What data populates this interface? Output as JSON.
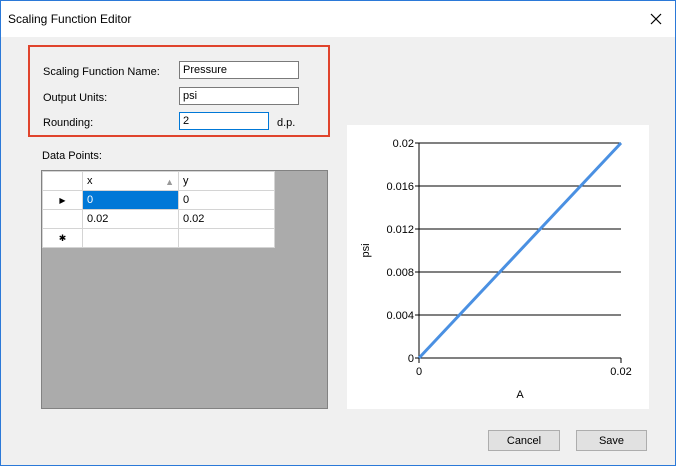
{
  "window": {
    "title": "Scaling Function Editor",
    "close_glyph": "✕"
  },
  "form": {
    "name_label": "Scaling Function Name:",
    "name_value": "Pressure",
    "units_label": "Output Units:",
    "units_value": "psi",
    "rounding_label": "Rounding:",
    "rounding_value": "2",
    "rounding_suffix": "d.p.",
    "highlight_color": "#e0442c"
  },
  "grid": {
    "label": "Data Points:",
    "columns": [
      "x",
      "y"
    ],
    "sorted_column": "x",
    "rows": [
      {
        "marker": "▶",
        "x": "0",
        "y": "0"
      },
      {
        "marker": "",
        "x": "0.02",
        "y": "0.02"
      },
      {
        "marker": "✱",
        "x": "",
        "y": ""
      }
    ]
  },
  "chart_data": {
    "type": "line",
    "title": "",
    "xlabel": "A",
    "ylabel": "psi",
    "xlim": [
      0,
      0.02
    ],
    "ylim": [
      0,
      0.02
    ],
    "x_ticks": [
      "0",
      "0.02"
    ],
    "y_ticks": [
      "0",
      "0.004",
      "0.008",
      "0.012",
      "0.016",
      "0.02"
    ],
    "grid": "horizontal",
    "series": [
      {
        "x": [
          0,
          0.02
        ],
        "y": [
          0,
          0.02
        ],
        "color": "#4a90e2"
      }
    ]
  },
  "buttons": {
    "cancel_label": "Cancel",
    "save_label": "Save"
  }
}
